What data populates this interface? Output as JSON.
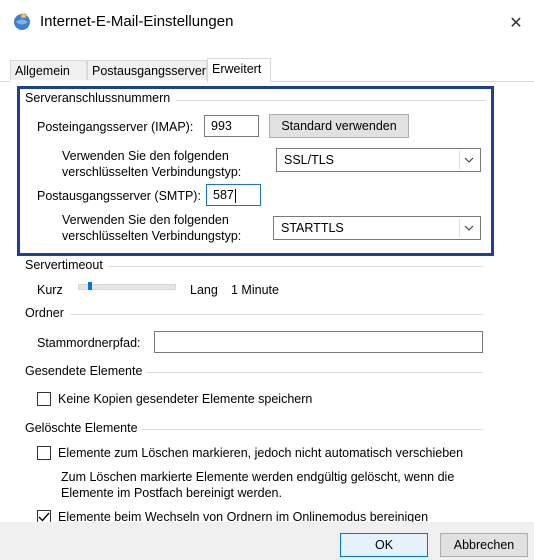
{
  "window": {
    "title": "Internet-E-Mail-Einstellungen",
    "close_glyph": "✕",
    "icons": {
      "app": "mail-globe-icon",
      "close": "close-icon"
    }
  },
  "tabs": [
    {
      "label": "Allgemein",
      "active": false
    },
    {
      "label": "Postausgangsserver",
      "active": false
    },
    {
      "label": "Erweitert",
      "active": true
    }
  ],
  "server_ports": {
    "group_title": "Serveranschlussnummern",
    "incoming_label": "Posteingangsserver (IMAP):",
    "incoming_value": "993",
    "default_button": "Standard verwenden",
    "incoming_encryption_label_line1": "Verwenden Sie den folgenden",
    "incoming_encryption_label_line2": "verschlüsselten Verbindungstyp:",
    "incoming_encryption_value": "SSL/TLS",
    "outgoing_label": "Postausgangsserver (SMTP):",
    "outgoing_value": "587",
    "outgoing_encryption_label_line1": "Verwenden Sie den folgenden",
    "outgoing_encryption_label_line2": "verschlüsselten Verbindungstyp:",
    "outgoing_encryption_value": "STARTTLS",
    "highlight_color": "#1f3f8f"
  },
  "timeout": {
    "group_title": "Servertimeout",
    "short_label": "Kurz",
    "long_label": "Lang",
    "value_text": "1 Minute",
    "slider_fraction": 0.1
  },
  "folders": {
    "group_title": "Ordner",
    "root_path_label": "Stammordnerpfad:",
    "root_path_value": ""
  },
  "sent_items": {
    "group_title": "Gesendete Elemente",
    "no_copies_label": "Keine Kopien gesendeter Elemente speichern",
    "no_copies_checked": false
  },
  "deleted_items": {
    "group_title": "Gelöschte Elemente",
    "mark_label": "Elemente zum Löschen markieren, jedoch nicht automatisch verschieben",
    "mark_checked": false,
    "info_line1": "Zum Löschen markierte Elemente werden endgültig gelöscht, wenn die",
    "info_line2": "Elemente im Postfach bereinigt werden.",
    "purge_label": "Elemente beim Wechseln von Ordnern im Onlinemodus bereinigen",
    "purge_checked": true
  },
  "footer": {
    "ok_label": "OK",
    "cancel_label": "Abbrechen"
  },
  "colors": {
    "accent": "#0078d7",
    "highlight_border": "#1f3f8f"
  }
}
